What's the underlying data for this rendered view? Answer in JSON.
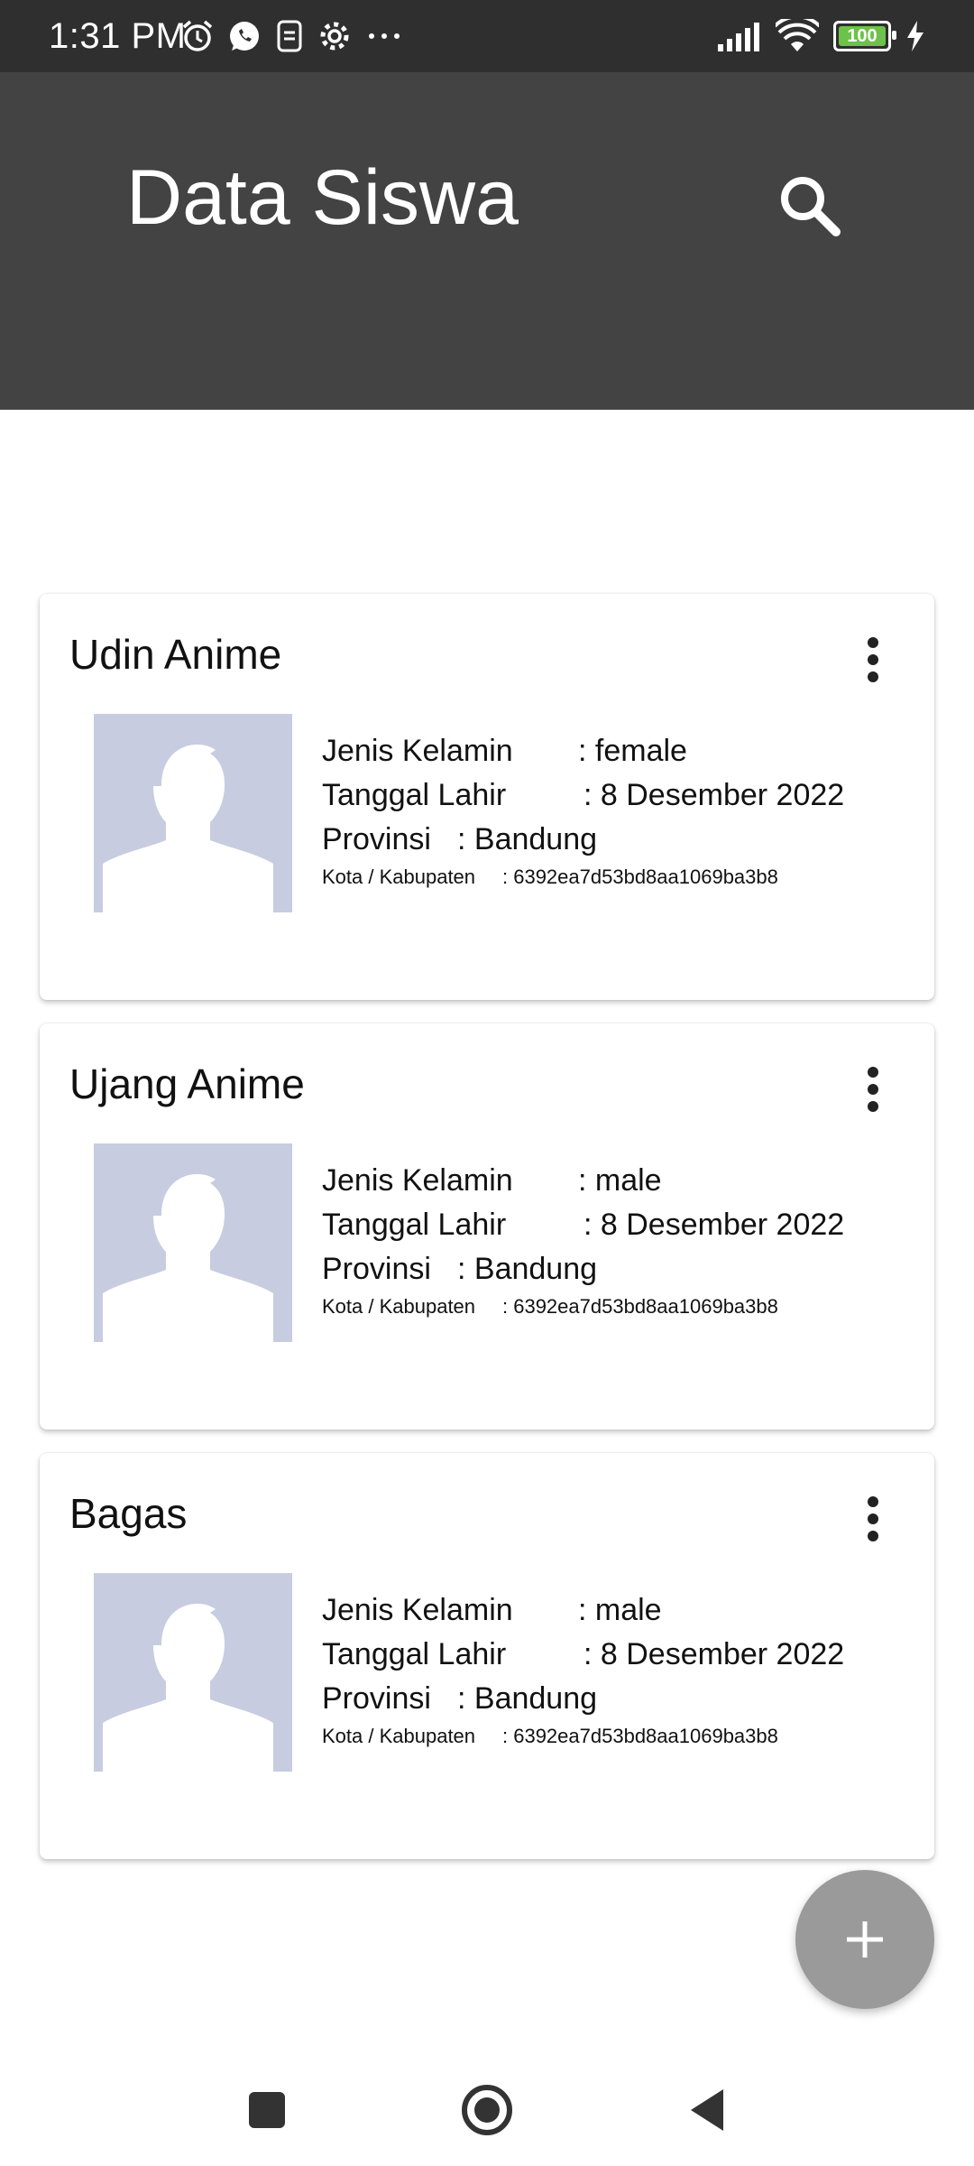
{
  "status_bar": {
    "time": "1:31 PM",
    "left_icons": [
      "alarm-icon",
      "whatsapp-icon",
      "sim-icon",
      "settings-icon",
      "more-icon"
    ],
    "battery": "100",
    "right_icons": [
      "signal-icon",
      "wifi-icon",
      "battery-icon",
      "charging-icon"
    ]
  },
  "appbar": {
    "title": "Data Siswa",
    "search_icon": "search-icon"
  },
  "students": [
    {
      "name": "Udin Anime",
      "gender_label": "Jenis Kelamin",
      "gender_value": ": female",
      "dob_label": "Tanggal Lahir",
      "dob_value": ": 8 Desember 2022",
      "province_label": "Provinsi",
      "province_value": ": Bandung",
      "city_label": "Kota / Kabupaten",
      "city_value": ": 6392ea7d53bd8aa1069ba3b8"
    },
    {
      "name": "Ujang Anime",
      "gender_label": "Jenis Kelamin",
      "gender_value": ": male",
      "dob_label": "Tanggal Lahir",
      "dob_value": ": 8 Desember 2022",
      "province_label": "Provinsi",
      "province_value": ": Bandung",
      "city_label": "Kota / Kabupaten",
      "city_value": ": 6392ea7d53bd8aa1069ba3b8"
    },
    {
      "name": "Bagas",
      "gender_label": "Jenis Kelamin",
      "gender_value": ": male",
      "dob_label": "Tanggal Lahir",
      "dob_value": ": 8 Desember 2022",
      "province_label": "Provinsi",
      "province_value": ": Bandung",
      "city_label": "Kota / Kabupaten",
      "city_value": ": 6392ea7d53bd8aa1069ba3b8"
    }
  ],
  "fab": {
    "icon": "plus-icon"
  },
  "nav": {
    "icons": [
      "recents-icon",
      "home-icon",
      "back-icon"
    ]
  },
  "colors": {
    "statusbar": "#2f2f2f",
    "appbar": "#434343",
    "avatar_bg": "#c7cce0",
    "fab": "#9a9a9a"
  }
}
